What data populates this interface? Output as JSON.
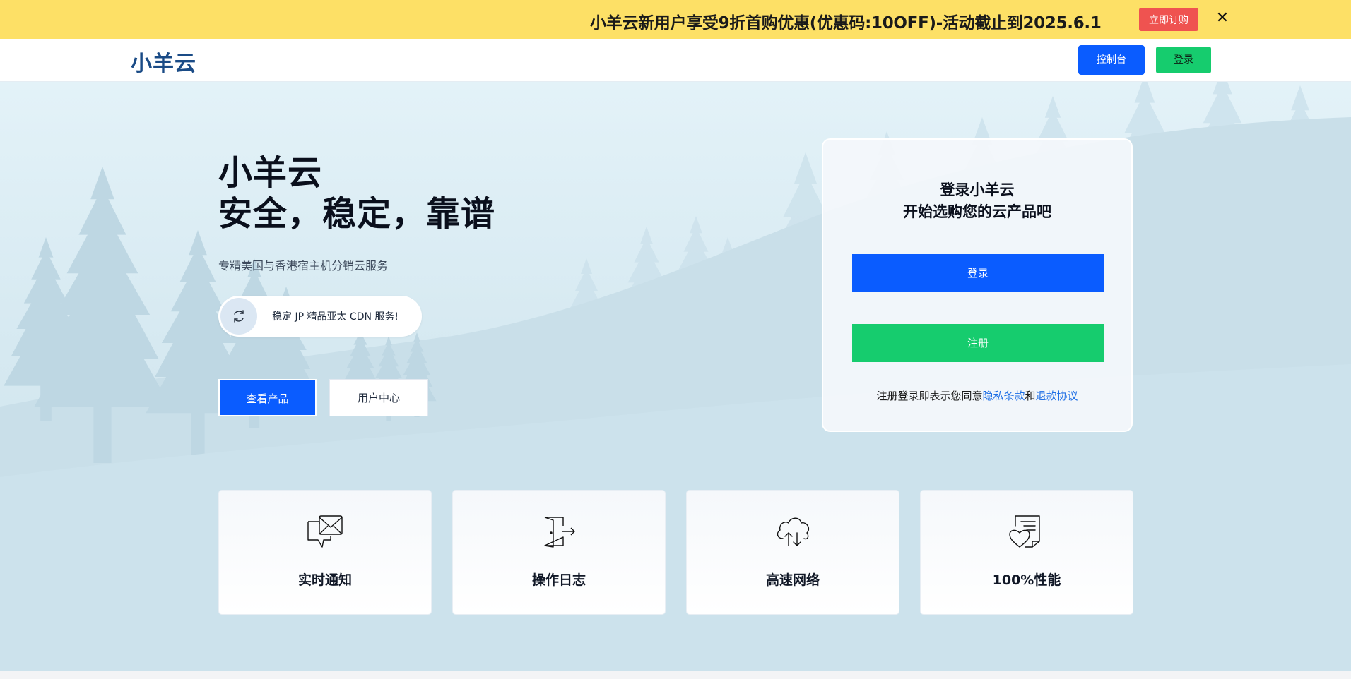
{
  "promo": {
    "text": "小羊云新用户享受9折首购优惠(优惠码:10OFF)-活动截止到2025.6.1",
    "button_label": "立即订购",
    "close_glyph": "✕",
    "background_color": "#fde066",
    "button_color": "#ef5350"
  },
  "header": {
    "logo": "小羊云",
    "console_label": "控制台",
    "login_label": "登录",
    "logo_color": "#1a4b86"
  },
  "hero": {
    "title_line1": "小羊云",
    "title_line2": "安全，稳定，靠谱",
    "subtitle": "专精美国与香港宿主机分销云服务",
    "pill_text": "稳定 JP 精品亚太 CDN 服务!",
    "pill_icon": "refresh-icon",
    "view_products_label": "查看产品",
    "user_center_label": "用户中心"
  },
  "login_card": {
    "title_line1": "登录小羊云",
    "title_line2": "开始选购您的云产品吧",
    "login_label": "登录",
    "register_label": "注册",
    "terms_prefix": "注册登录即表示您同意",
    "privacy_label": "隐私条款",
    "terms_and": "和",
    "refund_label": "退款协议"
  },
  "features": [
    {
      "label": "实时通知",
      "icon": "message-notification-icon"
    },
    {
      "label": "操作日志",
      "icon": "door-exit-icon"
    },
    {
      "label": "高速网络",
      "icon": "cloud-transfer-icon"
    },
    {
      "label": "100%性能",
      "icon": "document-heart-icon"
    }
  ],
  "colors": {
    "primary_blue": "#0a5cff",
    "primary_green": "#16cc6e",
    "link_blue": "#1f6fe5"
  }
}
